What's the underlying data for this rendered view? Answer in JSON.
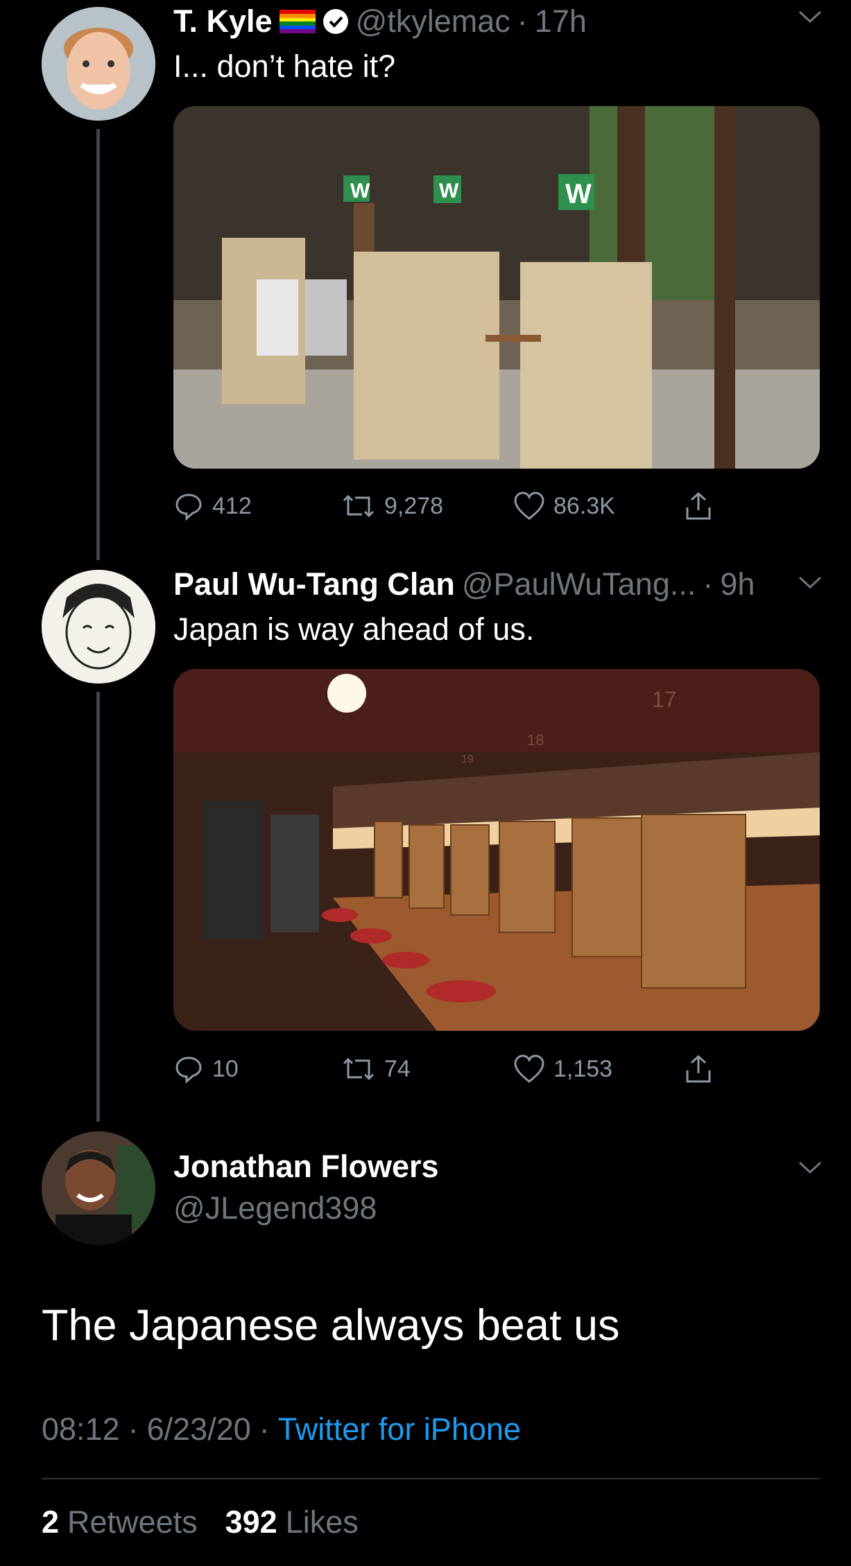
{
  "tweets": [
    {
      "name": "T. Kyle",
      "handle": "@tkylemac",
      "sep": " · ",
      "time": "17h",
      "text": "I... don’t hate it?",
      "replies": "412",
      "retweets": "9,278",
      "likes": "86.3K"
    },
    {
      "name": "Paul Wu-Tang Clan",
      "handle": "@PaulWuTang...",
      "sep": " · ",
      "time": "9h",
      "text": "Japan is way ahead of us.",
      "replies": "10",
      "retweets": "74",
      "likes": "1,153"
    }
  ],
  "focus": {
    "name": "Jonathan Flowers",
    "handle": "@JLegend398",
    "text": "The Japanese always beat us",
    "time": "08:12",
    "date": "6/23/20",
    "source": "Twitter for iPhone",
    "dot": "·",
    "retweet_count": "2",
    "retweet_label": "Retweets",
    "like_count": "392",
    "like_label": "Likes"
  },
  "photo1_signs": [
    "W",
    "W",
    "W"
  ],
  "photo2_numbers": [
    "17",
    "18",
    "19"
  ],
  "colors": {
    "accent": "#1d9bf0",
    "muted": "#6e767d",
    "line": "#3d4450"
  }
}
